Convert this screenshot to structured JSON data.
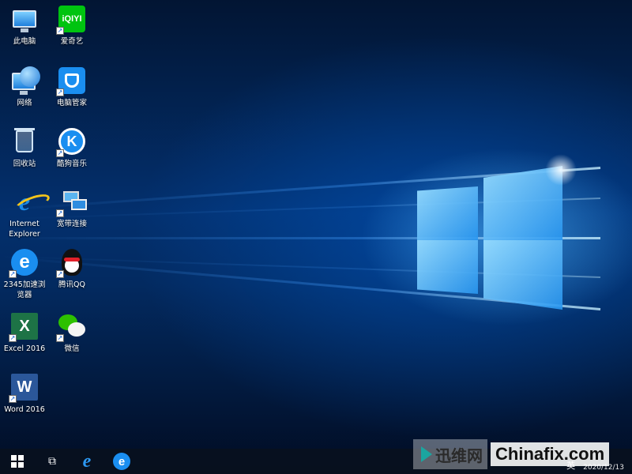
{
  "desktop": {
    "icons": [
      {
        "label": "此电脑",
        "icon": "computer-icon"
      },
      {
        "label": "爱奇艺",
        "icon": "iqiyi-icon",
        "badge": "iQIYI"
      },
      {
        "label": "网络",
        "icon": "network-icon"
      },
      {
        "label": "电脑管家",
        "icon": "tencent-pc-manager-icon"
      },
      {
        "label": "回收站",
        "icon": "recycle-bin-icon"
      },
      {
        "label": "酷狗音乐",
        "icon": "kugou-icon",
        "badge": "K"
      },
      {
        "label": "Internet Explorer",
        "icon": "internet-explorer-icon",
        "badge": "e"
      },
      {
        "label": "宽带连接",
        "icon": "broadband-connection-icon"
      },
      {
        "label": "2345加速浏览器",
        "icon": "browser-2345-icon",
        "badge": "e"
      },
      {
        "label": "腾讯QQ",
        "icon": "qq-icon"
      },
      {
        "label": "Excel 2016",
        "icon": "excel-icon",
        "badge": "X"
      },
      {
        "label": "微信",
        "icon": "wechat-icon"
      },
      {
        "label": "Word 2016",
        "icon": "word-icon",
        "badge": "W"
      }
    ]
  },
  "taskbar": {
    "start_icon": "windows-start-icon",
    "taskview_glyph": "⧉",
    "pinned": [
      {
        "icon": "internet-explorer-icon",
        "glyph": "e"
      },
      {
        "icon": "browser-2345-icon",
        "glyph": "e"
      }
    ],
    "tray": {
      "lang": "英",
      "date": "2020/12/13"
    }
  },
  "watermark": {
    "cn": "迅维网",
    "en": "Chinafix.com"
  },
  "colors": {
    "accent": "#1a8ef0",
    "taskbar": "#08101e"
  }
}
